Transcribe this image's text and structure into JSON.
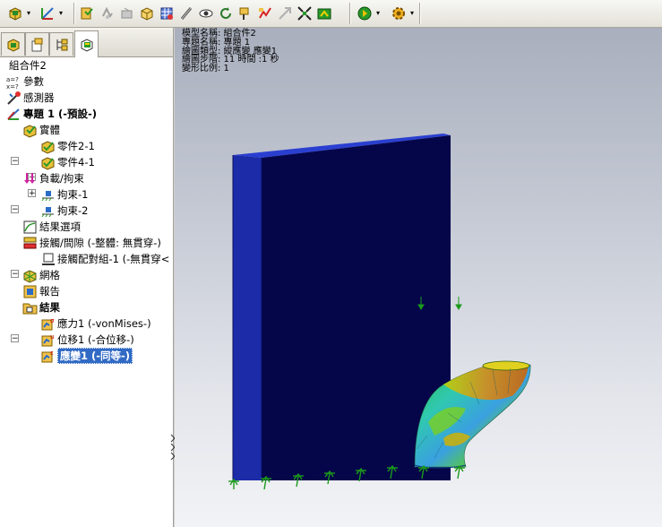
{
  "tree": {
    "root": "組合件2",
    "params": "參數",
    "sensors": "感測器",
    "study": "專題 1 (-預設-)",
    "solid": "實體",
    "part2": "零件2-1",
    "part4": "零件4-1",
    "loads": "負載/拘束",
    "fix1": "拘束-1",
    "fix2": "拘束-2",
    "result_options": "結果選項",
    "contact": "接觸/間隙 (-整體: 無貫穿-)",
    "contact_set": "接觸配對組-1 (-無貫穿<",
    "mesh": "網格",
    "report": "報告",
    "results": "結果",
    "stress": "應力1 (-vonMises-)",
    "displacement": "位移1 (-合位移-)",
    "strain": "應變1 (-同等-)"
  },
  "plot_info": {
    "model": "模型名稱: 組合件2",
    "study": "專題名稱: 專題 1",
    "plot_type": "繪圖類型: 縱應變 應變1",
    "step": "繪圖步階: 11   時間 :1 秒",
    "scale": "變形比例: 1"
  },
  "colors": {
    "plate_front": "#05054a",
    "plate_edge": "#1c2ba8",
    "plate_top": "#2a3fd0",
    "selection": "#316ac5",
    "fixture": "#1a9a1a"
  },
  "icons": {
    "toolbar": [
      "part-icon",
      "dropdown-icon",
      "triad-icon",
      "dropdown-icon",
      "plot-icon",
      "gray-tool-icon",
      "gray-tool-icon",
      "cube-icon",
      "mesh-icon",
      "probe-icon",
      "eye-icon",
      "refresh-icon",
      "pin-icon",
      "compare-icon",
      "gray-arrow-icon",
      "expand-icon",
      "export-icon",
      "animate-icon",
      "dropdown-icon",
      "settings-icon",
      "dropdown-icon"
    ]
  }
}
